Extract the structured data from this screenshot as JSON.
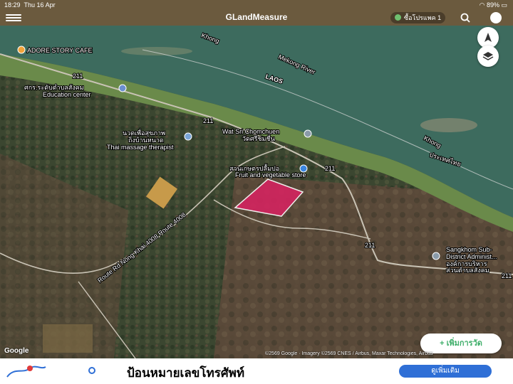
{
  "status": {
    "time": "18:29",
    "date": "Thu 16 Apr",
    "battery": "89%"
  },
  "navbar": {
    "title": "GLandMeasure",
    "pro_label": "ซื้อโปรแพค 1"
  },
  "icons": {
    "menu": "hamburger-icon",
    "search": "search-icon",
    "map_type": "map-type-icon",
    "location": "location-arrow-icon",
    "layers": "layers-icon"
  },
  "map": {
    "places": {
      "cafe": "ADORE STORY CAFE",
      "edu_th": "ศกร.ระดับตำบลสังคม",
      "edu_en": "Education center",
      "massage_th": "นวดเพื่อสุขภาพ",
      "massage_th2": "ถิ่งบ้านหนาด",
      "massage_en": "Thai massage therapist",
      "temple": "Wat Sri Chomchuen",
      "temple_th": "วัดศรีชมชื่น",
      "garden_th": "สวนเกษตรปลื้มปอ",
      "garden_en": "Fruit and vegetable store",
      "admin": "Sangkhom Sub-",
      "admin2": "District Administ...",
      "admin_th": "องค์การบริหาร",
      "admin_th2": "ส่วนตำบลสังคม"
    },
    "water": {
      "river": "Mekong River",
      "khong_top": "Khong",
      "khong_right": "Khong",
      "country": "LAOS",
      "thai": "ประเทศไทย"
    },
    "roads": {
      "road_label": "Route Rd Nong Khai 4008 Route 4008",
      "shield1": "211",
      "shield2": "211",
      "shield3": "211",
      "shield4": "211",
      "shield5": "211"
    },
    "attribution": "©2569 Google · Imagery ©2569 CNES / Airbus, Maxar Technologies, Airbus",
    "google": "Google",
    "add_point": "+  เพิ่มการวัด",
    "plot_color": "#d4245f"
  },
  "ad": {
    "text": "ป้อนหมายเลขโทรศัพท์",
    "button": "ดูเพิ่มเติม"
  }
}
